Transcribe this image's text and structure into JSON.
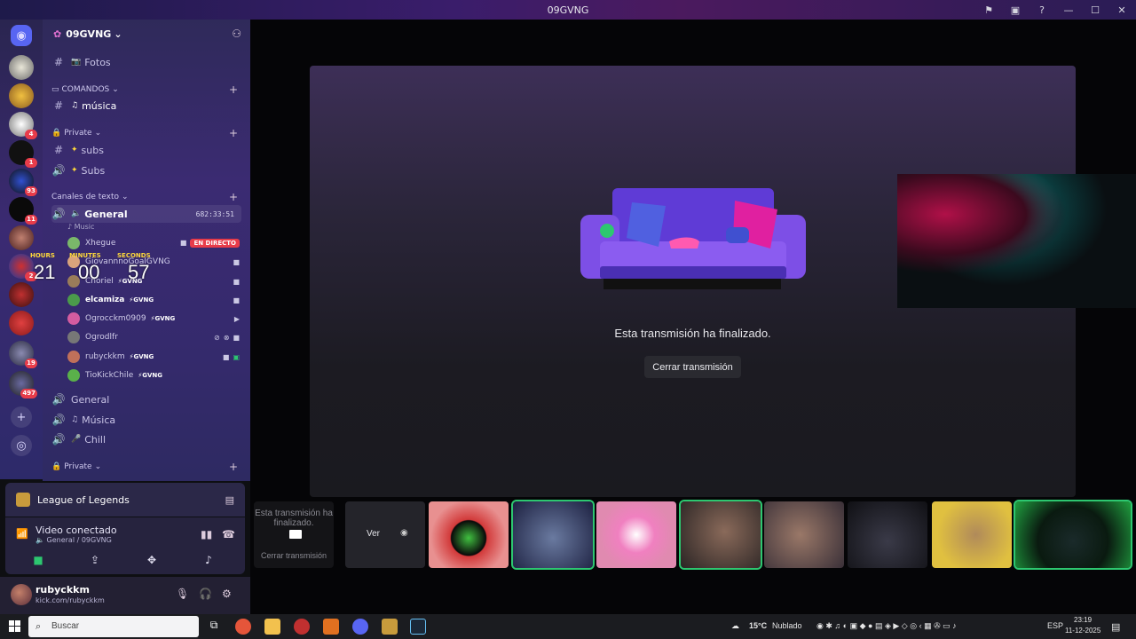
{
  "window": {
    "title": "09GVNG"
  },
  "server": {
    "name": "09GVNG"
  },
  "rail_badges": [
    "4",
    "1",
    "93",
    "11",
    "2",
    "19",
    "497"
  ],
  "channels": {
    "fotos": "Fotos",
    "cat_comandos": "COMANDOS",
    "musica": "música",
    "cat_private1": "Private",
    "subs_text": "subs",
    "subs_voice": "Subs",
    "cat_texto": "Canales de texto",
    "general": "General",
    "general_timer": "682:33:51",
    "general_status": "Music",
    "general1": "General",
    "musica_voice": "Música",
    "chill": "Chill",
    "cat_private2": "Private"
  },
  "voice_users": [
    {
      "name": "Xhegue",
      "live": "EN DIRECTO",
      "color": "#7ab86a"
    },
    {
      "name": "GiovannnoGoalGVNG",
      "tag": "GVNG",
      "color": "#d9a37c"
    },
    {
      "name": "Choriel",
      "tag": "GVNG",
      "color": "#9a7c5a"
    },
    {
      "name": "elcamiza",
      "tag": "GVNG",
      "color": "#4b9a4b"
    },
    {
      "name": "Ogrocckm0909",
      "tag": "GVNG",
      "color": "#d45ca0"
    },
    {
      "name": "Ogrodlfr",
      "tag": "",
      "color": "#777777"
    },
    {
      "name": "rubyckkm",
      "tag": "GVNG",
      "color": "#c0705a"
    },
    {
      "name": "TioKickChile",
      "tag": "GVNG",
      "color": "#5ab04a"
    }
  ],
  "overlay_timer": {
    "hours_label": "HOURS",
    "minutes_label": "MINUTES",
    "seconds_label": "SECONDS",
    "hours": "21",
    "minutes": "00",
    "seconds": "57"
  },
  "game_activity": "League of Legends",
  "voice_status": {
    "title": "Video conectado",
    "sub": "General / 09GVNG"
  },
  "me": {
    "name": "rubyckkm",
    "status": "kick.com/rubyckkm"
  },
  "stream": {
    "ended_message": "Esta transmisión ha finalizado.",
    "close_button": "Cerrar transmisión"
  },
  "thumbs": {
    "t0_line1": "Esta transmisión ha finalizado.",
    "t0_line2": "Cerrar transmisión",
    "t1_label": "Ver"
  },
  "taskbar": {
    "search_placeholder": "Buscar",
    "weather": "15°C",
    "weather_desc": "Nublado",
    "lang": "ESP",
    "time": "23:19",
    "date": "11-12-2025"
  }
}
